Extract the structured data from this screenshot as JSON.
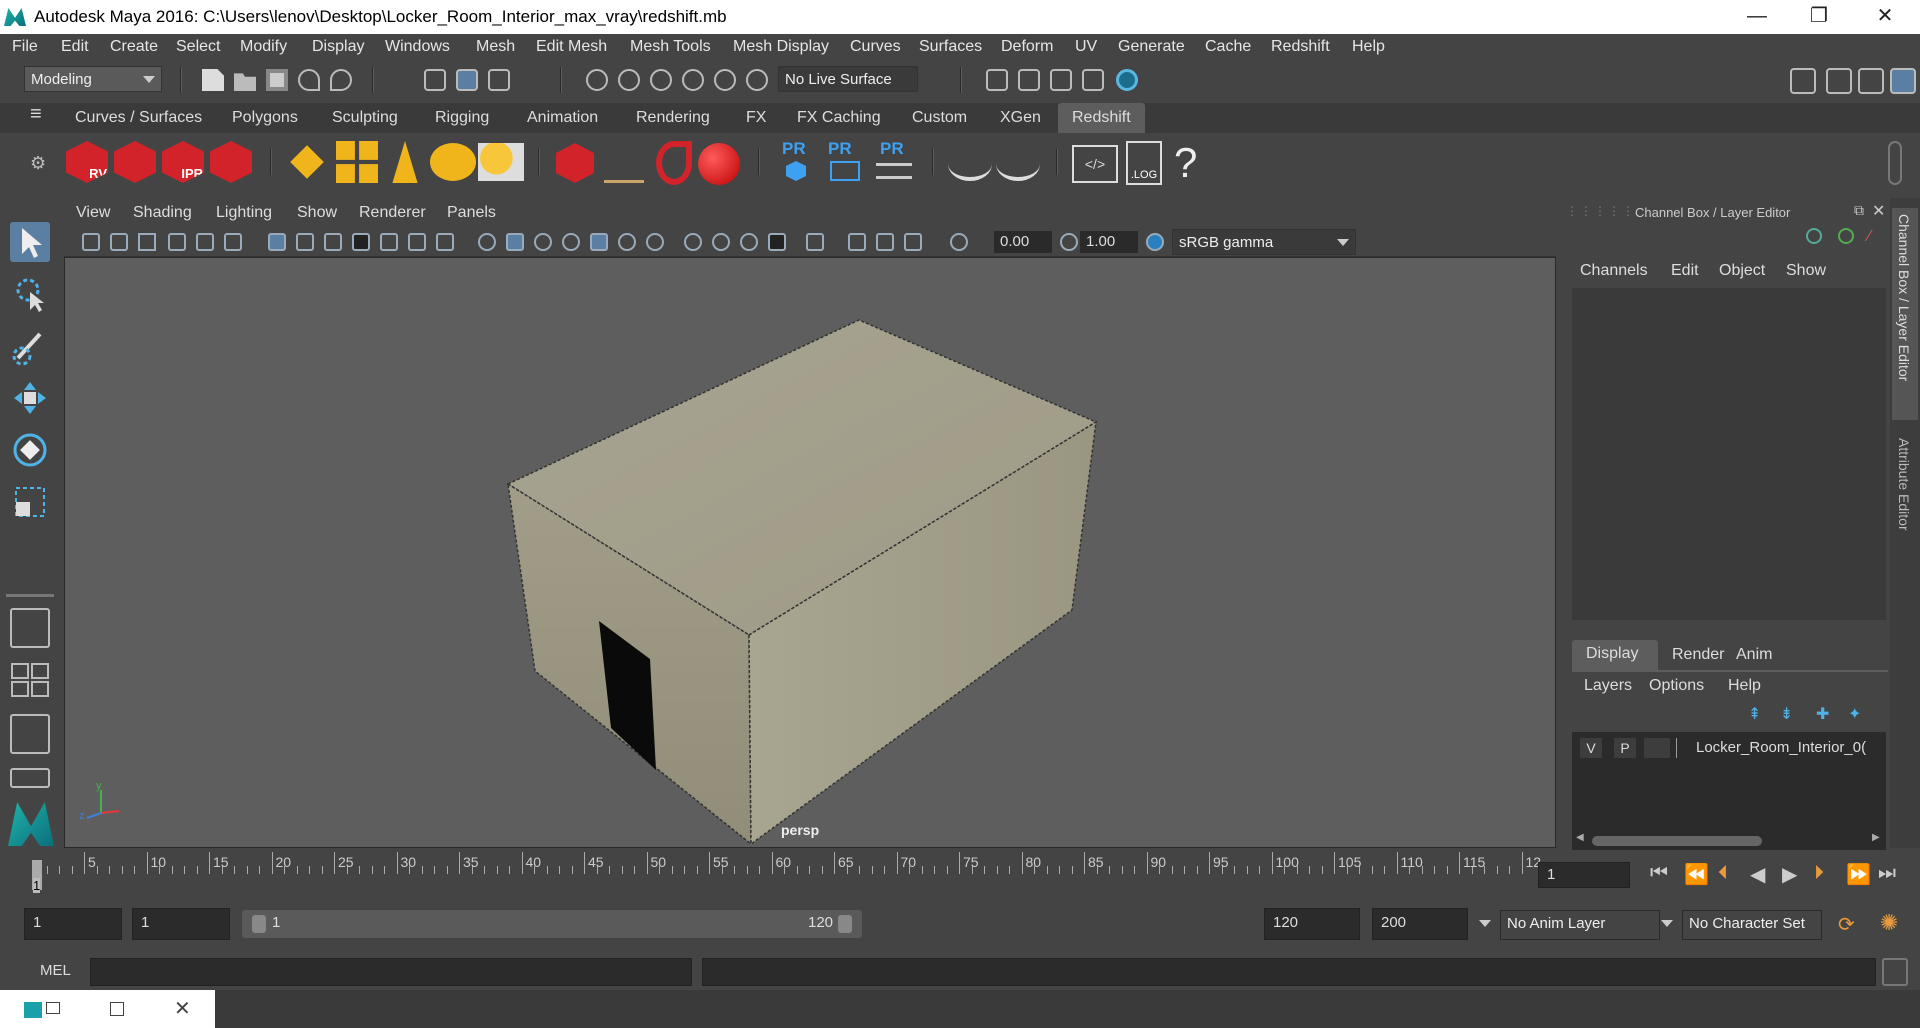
{
  "window": {
    "title": "Autodesk Maya 2016: C:\\Users\\lenov\\Desktop\\Locker_Room_Interior_max_vray\\redshift.mb",
    "minimize": "—",
    "maximize": "❐",
    "close": "✕"
  },
  "menubar": [
    "File",
    "Edit",
    "Create",
    "Select",
    "Modify",
    "Display",
    "Windows",
    "Mesh",
    "Edit Mesh",
    "Mesh Tools",
    "Mesh Display",
    "Curves",
    "Surfaces",
    "Deform",
    "UV",
    "Generate",
    "Cache",
    "Redshift",
    "Help"
  ],
  "status": {
    "mode": "Modeling",
    "live_surface": "No Live Surface"
  },
  "shelf_tabs": [
    "Curves / Surfaces",
    "Polygons",
    "Sculpting",
    "Rigging",
    "Animation",
    "Rendering",
    "FX",
    "FX Caching",
    "Custom",
    "XGen",
    "Redshift"
  ],
  "shelf_active": "Redshift",
  "shelf_icons": {
    "rv": "RV",
    "ipr": "IPR",
    "pr": "PR",
    "log": ".LOG",
    "help": "?"
  },
  "viewport_menu": [
    "View",
    "Shading",
    "Lighting",
    "Show",
    "Renderer",
    "Panels"
  ],
  "viewport_toolbar": {
    "exposure": "0.00",
    "gamma": "1.00",
    "color_space": "sRGB gamma"
  },
  "viewport": {
    "camera": "persp",
    "axis_y": "y",
    "axis_z": "z"
  },
  "channel_box": {
    "title": "Channel Box / Layer Editor",
    "menu": [
      "Channels",
      "Edit",
      "Object",
      "Show"
    ],
    "layer_tabs": [
      "Display",
      "Render",
      "Anim"
    ],
    "layer_menu": [
      "Layers",
      "Options",
      "Help"
    ],
    "layer_row": {
      "v": "V",
      "p": "P",
      "name": "Locker_Room_Interior_0("
    }
  },
  "side_tabs": [
    "Channel Box / Layer Editor",
    "Attribute Editor"
  ],
  "timeline": {
    "ticks": [
      "5",
      "10",
      "15",
      "20",
      "25",
      "30",
      "35",
      "40",
      "45",
      "50",
      "55",
      "60",
      "65",
      "70",
      "75",
      "80",
      "85",
      "90",
      "95",
      "100",
      "105",
      "110",
      "115",
      "12"
    ],
    "current_marker": "1",
    "current_frame": "1"
  },
  "range": {
    "start": "1",
    "current": "1",
    "slider_start": "1",
    "slider_end": "120",
    "end": "120",
    "max": "200",
    "anim_layer": "No Anim Layer",
    "char_set": "No Character Set"
  },
  "command": {
    "label": "MEL"
  }
}
